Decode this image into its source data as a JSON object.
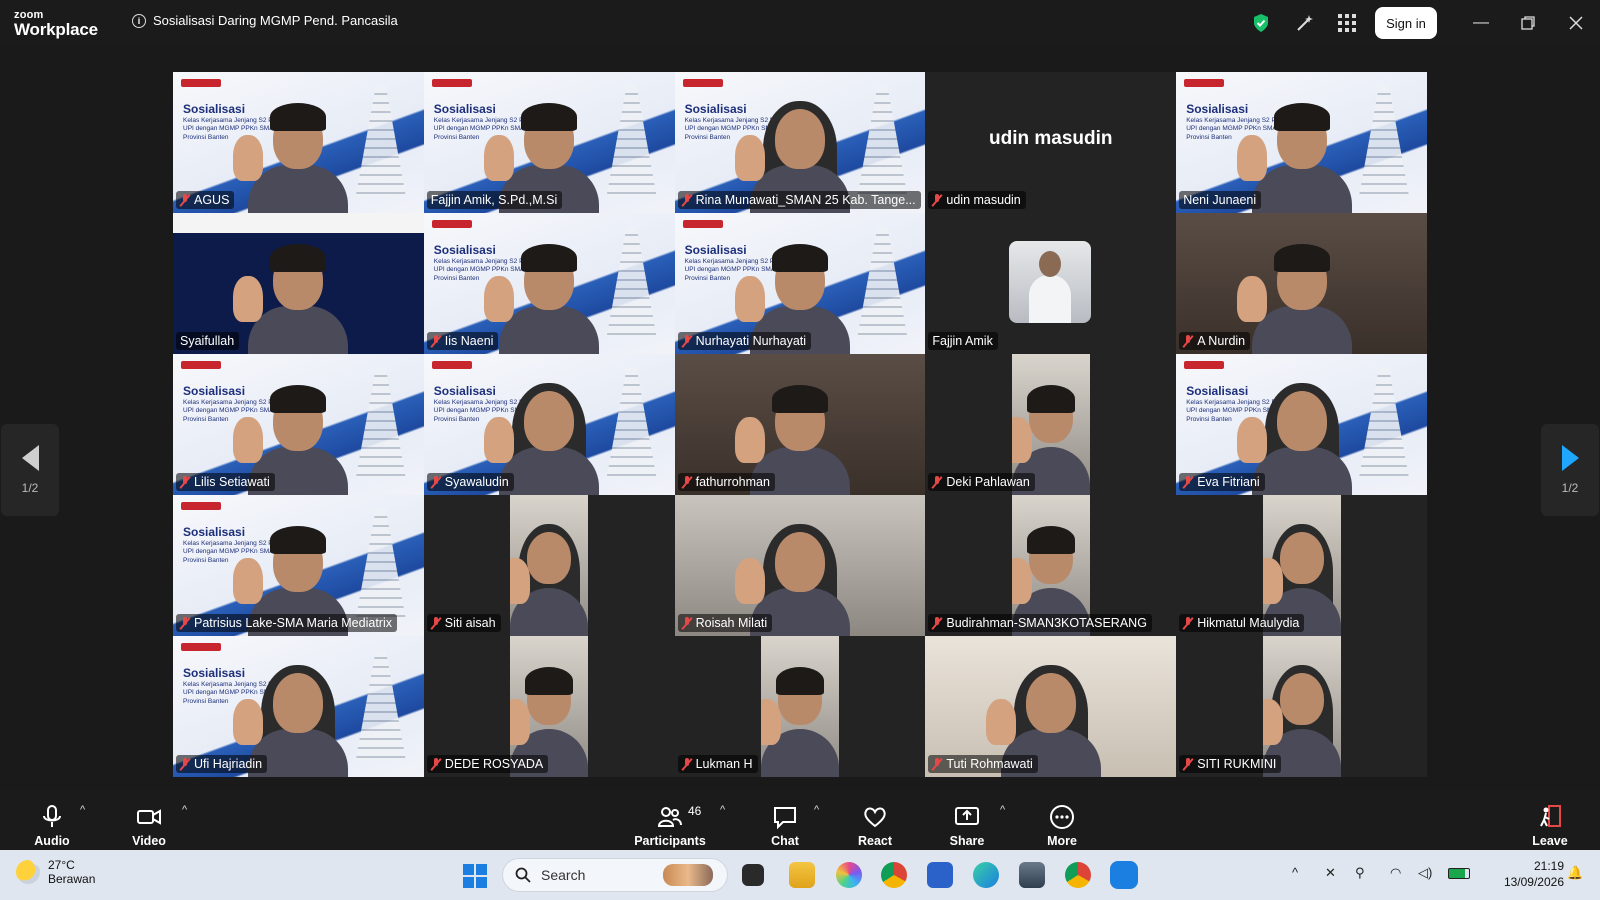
{
  "app": {
    "brand_top": "zoom",
    "brand_bottom": "Workplace",
    "meeting_title": "Sosialisasi Daring MGMP Pend. Pancasila",
    "sign_in": "Sign in"
  },
  "colors": {
    "accent_green": "#2fd29a",
    "mute_red": "#e64848",
    "pager_blue": "#1fa6ff",
    "shield_green": "#18c06a"
  },
  "gallery": {
    "page_indicator": "1/2",
    "speaker_big_name": "udin masudin",
    "tiles": [
      {
        "name": "AGUS",
        "muted": true,
        "bg": "slide"
      },
      {
        "name": "Fajjin Amik, S.Pd.,M.Si",
        "muted": false,
        "bg": "slide"
      },
      {
        "name": "Rina Munawati_SMAN 25 Kab. Tange...",
        "muted": true,
        "bg": "slide"
      },
      {
        "name": "udin masudin",
        "muted": true,
        "bg": "name"
      },
      {
        "name": "Neni Junaeni",
        "muted": false,
        "bg": "slide",
        "speaking": true
      },
      {
        "name": "Syaifullah",
        "muted": false,
        "bg": "dark"
      },
      {
        "name": "Iis Naeni",
        "muted": true,
        "bg": "slide"
      },
      {
        "name": "Nurhayati Nurhayati",
        "muted": true,
        "bg": "slide"
      },
      {
        "name": "Fajjin Amik",
        "muted": false,
        "bg": "avatar"
      },
      {
        "name": "A Nurdin",
        "muted": true,
        "bg": "room"
      },
      {
        "name": "Lilis Setiawati",
        "muted": true,
        "bg": "slide"
      },
      {
        "name": "Syawaludin",
        "muted": true,
        "bg": "slide"
      },
      {
        "name": "fathurrohman",
        "muted": true,
        "bg": "room"
      },
      {
        "name": "Deki Pahlawan",
        "muted": true,
        "bg": "portrait"
      },
      {
        "name": "Eva Fitriani",
        "muted": true,
        "bg": "slide"
      },
      {
        "name": "Patrisius Lake-SMA Maria Mediatrix",
        "muted": true,
        "bg": "slide"
      },
      {
        "name": "Siti aisah",
        "muted": true,
        "bg": "portrait"
      },
      {
        "name": "Roisah Milati",
        "muted": true,
        "bg": "grey"
      },
      {
        "name": "Budirahman-SMAN3KOTASERANG",
        "muted": true,
        "bg": "portrait"
      },
      {
        "name": "Hikmatul Maulydia",
        "muted": true,
        "bg": "portrait"
      },
      {
        "name": "Ufi Hajriadin",
        "muted": true,
        "bg": "slide"
      },
      {
        "name": "DEDE ROSYADA",
        "muted": true,
        "bg": "portrait"
      },
      {
        "name": "Lukman H",
        "muted": true,
        "bg": "portrait"
      },
      {
        "name": "Tuti Rohmawati",
        "muted": true,
        "bg": "warm"
      },
      {
        "name": "SITI RUKMINI",
        "muted": true,
        "bg": "portrait"
      }
    ]
  },
  "slide": {
    "heading": "Sosialisasi",
    "sub": "Kelas Kerjasama Jenjang S2 PKn UPI dengan MGMP PPKn SMA Provinsi Banten"
  },
  "toolbar": {
    "audio": "Audio",
    "video": "Video",
    "participants": "Participants",
    "participant_count": "46",
    "chat": "Chat",
    "react": "React",
    "share": "Share",
    "more": "More",
    "leave": "Leave"
  },
  "taskbar": {
    "temperature": "27°C",
    "weather": "Berawan",
    "search_placeholder": "Search",
    "time": "21:19",
    "date": "13/09/2026"
  }
}
